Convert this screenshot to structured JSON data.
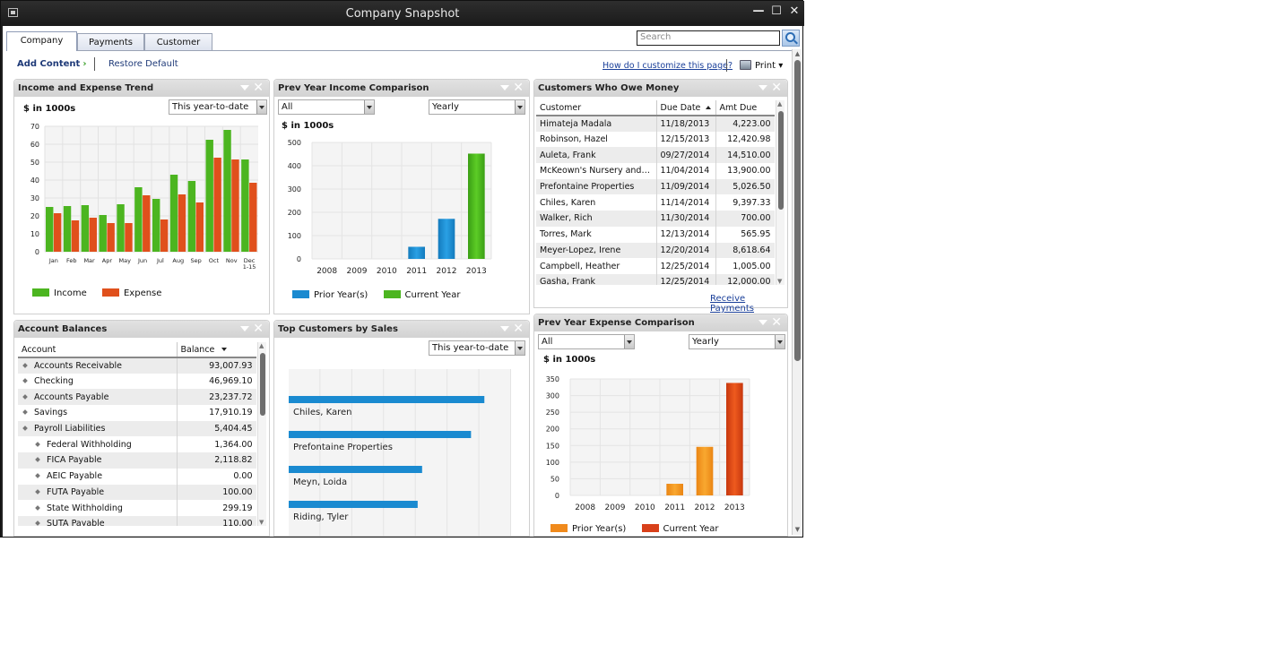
{
  "window": {
    "title": "Company Snapshot",
    "controls": {
      "minimize": "—",
      "maximize": "☐",
      "close": "✕"
    }
  },
  "tabs": [
    {
      "label": "Company",
      "active": true
    },
    {
      "label": "Payments",
      "active": false
    },
    {
      "label": "Customer",
      "active": false
    }
  ],
  "search": {
    "placeholder": "Search",
    "value": ""
  },
  "toolbar": {
    "add_content": "Add Content",
    "add_content_chevron": "›",
    "restore_default": "Restore Default",
    "help_link": "How do I customize this page?",
    "print": "Print",
    "print_caret": "▾"
  },
  "panels": {
    "income_expense": {
      "title": "Income and Expense Trend",
      "units": "$ in 1000s",
      "period": "This year-to-date"
    },
    "prev_income": {
      "title": "Prev Year Income Comparison",
      "filter": "All",
      "period": "Yearly",
      "units": "$ in 1000s"
    },
    "customers_owe": {
      "title": "Customers Who Owe Money",
      "columns": [
        "Customer",
        "Due Date",
        "Amt Due"
      ],
      "sorted_column": "Due Date",
      "rows": [
        [
          "Himateja Madala",
          "11/18/2013",
          "4,223.00"
        ],
        [
          "Robinson, Hazel",
          "12/15/2013",
          "12,420.98"
        ],
        [
          "Auleta, Frank",
          "09/27/2014",
          "14,510.00"
        ],
        [
          "McKeown's Nursery and G...",
          "11/04/2014",
          "13,900.00"
        ],
        [
          "Prefontaine Properties",
          "11/09/2014",
          "5,026.50"
        ],
        [
          "Chiles, Karen",
          "11/14/2014",
          "9,397.33"
        ],
        [
          "Walker, Rich",
          "11/30/2014",
          "700.00"
        ],
        [
          "Torres, Mark",
          "12/13/2014",
          "565.95"
        ],
        [
          "Meyer-Lopez, Irene",
          "12/20/2014",
          "8,618.64"
        ],
        [
          "Campbell, Heather",
          "12/25/2014",
          "1,005.00"
        ],
        [
          "Gasha, Frank",
          "12/25/2014",
          "12,000.00"
        ]
      ],
      "link": "Receive Payments"
    },
    "account_balances": {
      "title": "Account Balances",
      "columns": [
        "Account",
        "Balance"
      ],
      "rows": [
        {
          "name": "Accounts Receivable",
          "balance": "93,007.93",
          "level": 0
        },
        {
          "name": "Checking",
          "balance": "46,969.10",
          "level": 0
        },
        {
          "name": "Accounts Payable",
          "balance": "23,237.72",
          "level": 0
        },
        {
          "name": "Savings",
          "balance": "17,910.19",
          "level": 0
        },
        {
          "name": "Payroll Liabilities",
          "balance": "5,404.45",
          "level": 0
        },
        {
          "name": "Federal Withholding",
          "balance": "1,364.00",
          "level": 1
        },
        {
          "name": "FICA Payable",
          "balance": "2,118.82",
          "level": 1
        },
        {
          "name": "AEIC Payable",
          "balance": "0.00",
          "level": 1
        },
        {
          "name": "FUTA Payable",
          "balance": "100.00",
          "level": 1
        },
        {
          "name": "State Withholding",
          "balance": "299.19",
          "level": 1
        },
        {
          "name": "SUTA Payable",
          "balance": "110.00",
          "level": 1
        }
      ]
    },
    "top_customers": {
      "title": "Top Customers by Sales",
      "period": "This year-to-date"
    },
    "prev_expense": {
      "title": "Prev Year Expense Comparison",
      "filter": "All",
      "period": "Yearly",
      "units": "$ in 1000s"
    }
  },
  "chart_data": [
    {
      "id": "income_expense",
      "type": "bar",
      "title": "Income and Expense Trend",
      "ylabel": "$ in 1000s",
      "categories": [
        "Jan",
        "Feb",
        "Mar",
        "Apr",
        "May",
        "Jun",
        "Jul",
        "Aug",
        "Sep",
        "Oct",
        "Nov",
        "Dec 1-15"
      ],
      "series": [
        {
          "name": "Income",
          "color": "#4cb520",
          "values": [
            25,
            25.5,
            26,
            20.5,
            26.5,
            36,
            29.5,
            43,
            39.5,
            62.5,
            68,
            51.5
          ]
        },
        {
          "name": "Expense",
          "color": "#e0501c",
          "values": [
            21.5,
            17.5,
            19,
            16,
            16,
            31.5,
            18,
            32,
            27.5,
            52.5,
            51.5,
            38.5
          ]
        }
      ],
      "ylim": [
        0,
        70
      ],
      "yticks": [
        0,
        10,
        20,
        30,
        40,
        50,
        60,
        70
      ],
      "grid": true,
      "legend": "bottom-left"
    },
    {
      "id": "prev_income",
      "type": "bar",
      "title": "Prev Year Income Comparison",
      "ylabel": "$ in 1000s",
      "categories": [
        "2008",
        "2009",
        "2010",
        "2011",
        "2012",
        "2013"
      ],
      "values": [
        0,
        0,
        0,
        52,
        172,
        452
      ],
      "series_by_category": [
        "Prior Year(s)",
        "Prior Year(s)",
        "Prior Year(s)",
        "Prior Year(s)",
        "Prior Year(s)",
        "Current Year"
      ],
      "legend_entries": [
        {
          "name": "Prior Year(s)",
          "color": "#1a8ad0"
        },
        {
          "name": "Current Year",
          "color": "#4cb520"
        }
      ],
      "ylim": [
        0,
        500
      ],
      "yticks": [
        0,
        100,
        200,
        300,
        400,
        500
      ],
      "grid": true,
      "legend": "bottom-left"
    },
    {
      "id": "top_customers",
      "type": "bar",
      "orientation": "horizontal",
      "title": "Top Customers by Sales",
      "categories": [
        "Chiles, Karen",
        "Prefontaine Properties",
        "Meyn, Loida",
        "Riding, Tyler"
      ],
      "values": [
        0.88,
        0.82,
        0.6,
        0.58
      ],
      "value_units": "fraction of axis width",
      "color": "#1a8ad0",
      "grid": true
    },
    {
      "id": "prev_expense",
      "type": "bar",
      "title": "Prev Year Expense Comparison",
      "ylabel": "$ in 1000s",
      "categories": [
        "2008",
        "2009",
        "2010",
        "2011",
        "2012",
        "2013"
      ],
      "values": [
        0,
        0,
        0,
        35,
        146,
        338
      ],
      "series_by_category": [
        "Prior Year(s)",
        "Prior Year(s)",
        "Prior Year(s)",
        "Prior Year(s)",
        "Prior Year(s)",
        "Current Year"
      ],
      "legend_entries": [
        {
          "name": "Prior Year(s)",
          "color": "#f08a1c"
        },
        {
          "name": "Current Year",
          "color": "#d8401a"
        }
      ],
      "ylim": [
        0,
        350
      ],
      "yticks": [
        0,
        50,
        100,
        150,
        200,
        250,
        300,
        350
      ],
      "grid": true,
      "legend": "bottom-left"
    }
  ]
}
